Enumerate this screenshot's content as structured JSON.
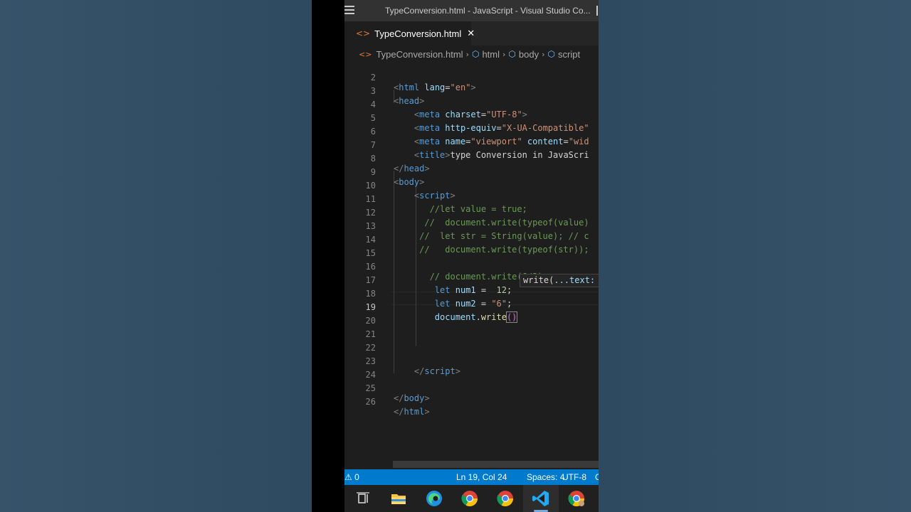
{
  "window": {
    "title": "TypeConversion.html - JavaScript - Visual Studio Co..."
  },
  "tab": {
    "label": "TypeConversion.html",
    "close": "✕"
  },
  "breadcrumb": {
    "file": "TypeConversion.html",
    "items": [
      "html",
      "body",
      "script"
    ]
  },
  "editor": {
    "lines": [
      {
        "n": "2"
      },
      {
        "n": "3"
      },
      {
        "n": "4"
      },
      {
        "n": "5"
      },
      {
        "n": "6"
      },
      {
        "n": "7"
      },
      {
        "n": "8"
      },
      {
        "n": "9"
      },
      {
        "n": "10"
      },
      {
        "n": "11"
      },
      {
        "n": "12"
      },
      {
        "n": "13"
      },
      {
        "n": "14"
      },
      {
        "n": "15"
      },
      {
        "n": "16"
      },
      {
        "n": "17"
      },
      {
        "n": "18"
      },
      {
        "n": "19"
      },
      {
        "n": "20"
      },
      {
        "n": "21"
      },
      {
        "n": "22"
      },
      {
        "n": "23"
      },
      {
        "n": "24"
      },
      {
        "n": "25"
      },
      {
        "n": "26"
      }
    ],
    "code": {
      "l2_tag": "html",
      "l2_attr": "lang",
      "l2_val": "\"en\"",
      "l3_tag": "head",
      "l4_tag": "meta",
      "l4_attr": "charset",
      "l4_val": "\"UTF-8\"",
      "l5_tag": "meta",
      "l5_attr": "http-equiv",
      "l5_val": "\"X-UA-Compatible\"",
      "l6_tag": "meta",
      "l6_attr": "name",
      "l6_val": "\"viewport\"",
      "l6_attr2": "content",
      "l6_val2": "\"wid",
      "l7_tag": "title",
      "l7_text": "type Conversion in JavaScri",
      "l8_tag": "head",
      "l9_tag": "body",
      "l10_tag": "script",
      "l11": "//let value = true;",
      "l12": "//  document.write(typeof(value)",
      "l13": "//  let str = String(value); // c",
      "l14": "//   document.write(typeof(str));",
      "l16": "// document.write(6/3);",
      "l17_kw": "let",
      "l17_var": "num1",
      "l17_num": "12",
      "l18_kw": "let",
      "l18_var": "num2",
      "l18_str": "\"6\"",
      "l19_obj": "document",
      "l19_fn": "write",
      "l23_tag": "script",
      "l25_tag": "body",
      "l26_tag": "html"
    },
    "hover_tip": {
      "fn": "write(",
      "param": "...text:"
    }
  },
  "status_bar": {
    "problems": "⚠ 0",
    "position": "Ln 19, Col 24",
    "spaces": "Spaces: 4",
    "encoding": "UTF-8",
    "more": "C"
  },
  "taskbar": {
    "items": [
      "task-view-icon",
      "file-explorer-icon",
      "edge-icon",
      "chrome-icon",
      "chrome-icon",
      "vscode-icon",
      "chrome-icon"
    ]
  },
  "colors": {
    "status_bar": "#007acc",
    "editor_bg": "#1e1e1e",
    "title_bar": "#323233",
    "page_bg": "#2f4a60"
  }
}
